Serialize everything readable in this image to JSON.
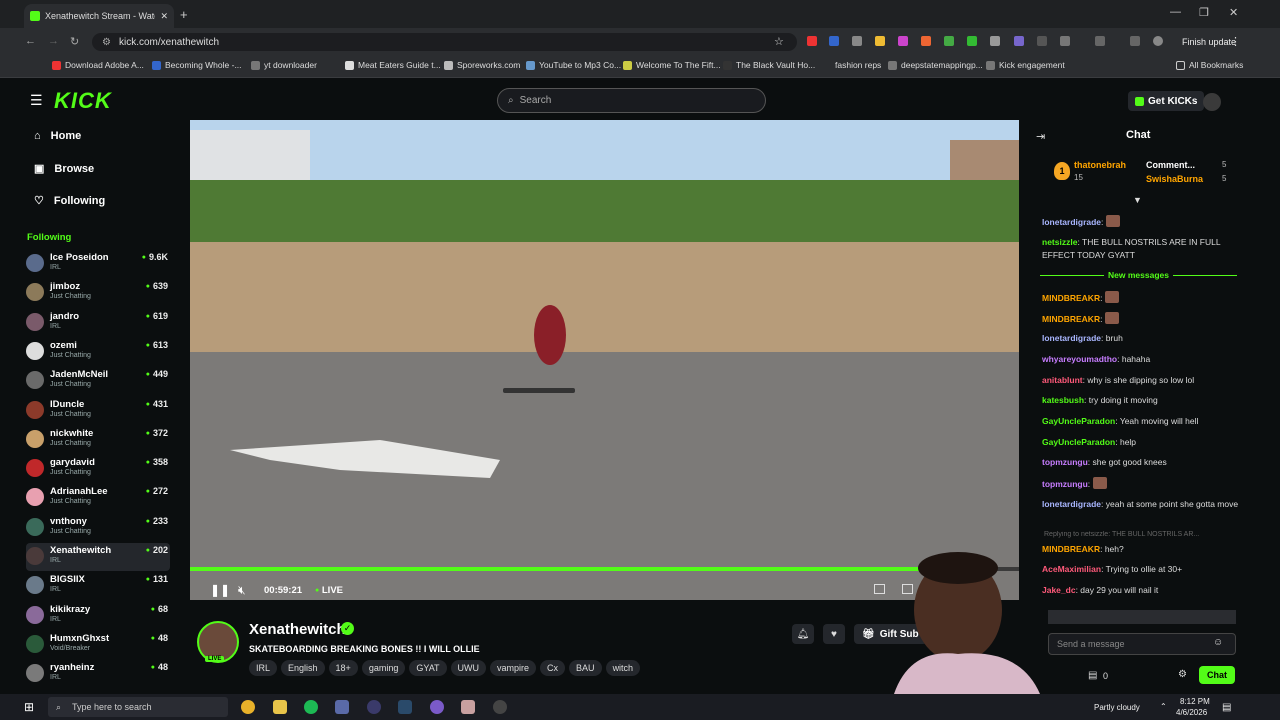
{
  "browser": {
    "tab_title": "Xenathewitch Stream - Watch l",
    "url": "kick.com/xenathewitch",
    "finish_update": "Finish update",
    "bookmarks": [
      "Download Adobe A...",
      "Becoming Whole -...",
      "yt downloader",
      "Meat Eaters Guide t...",
      "Sporeworks.com",
      "YouTube to Mp3 Co...",
      "Welcome To The Fift...",
      "The Black Vault Ho...",
      "fashion reps",
      "deepstatemappingp...",
      "Kick engagement"
    ],
    "all_bookmarks": "All Bookmarks"
  },
  "header": {
    "logo": "KICK",
    "search_placeholder": "Search",
    "get_kicks": "Get KICKs"
  },
  "nav": {
    "home": "Home",
    "browse": "Browse",
    "following": "Following"
  },
  "following_title": "Following",
  "following": [
    {
      "name": "Ice Poseidon",
      "cat": "IRL",
      "viewers": "9.6K",
      "color": "#5a6b8c"
    },
    {
      "name": "jimboz",
      "cat": "Just Chatting",
      "viewers": "639",
      "color": "#8c7a5a"
    },
    {
      "name": "jandro",
      "cat": "IRL",
      "viewers": "619",
      "color": "#7a5a6a"
    },
    {
      "name": "ozemi",
      "cat": "Just Chatting",
      "viewers": "613",
      "color": "#dddddd"
    },
    {
      "name": "JadenMcNeil",
      "cat": "Just Chatting",
      "viewers": "449",
      "color": "#6a6a6a"
    },
    {
      "name": "IDuncle",
      "cat": "Just Chatting",
      "viewers": "431",
      "color": "#8c3a2a"
    },
    {
      "name": "nickwhite",
      "cat": "Just Chatting",
      "viewers": "372",
      "color": "#c9a06a"
    },
    {
      "name": "garydavid",
      "cat": "Just Chatting",
      "viewers": "358",
      "color": "#c0282a"
    },
    {
      "name": "AdrianahLee",
      "cat": "Just Chatting",
      "viewers": "272",
      "color": "#e8a0b0"
    },
    {
      "name": "vnthony",
      "cat": "Just Chatting",
      "viewers": "233",
      "color": "#3a6a5a"
    },
    {
      "name": "Xenathewitch",
      "cat": "IRL",
      "viewers": "202",
      "color": "#4a3a3a"
    },
    {
      "name": "BIGSIIX",
      "cat": "IRL",
      "viewers": "131",
      "color": "#6a7a8a"
    },
    {
      "name": "kikikrazy",
      "cat": "IRL",
      "viewers": "68",
      "color": "#8a6a9a"
    },
    {
      "name": "HumxnGhxst",
      "cat": "Void/Breaker",
      "viewers": "48",
      "color": "#2a5a3a"
    },
    {
      "name": "ryanheinz",
      "cat": "IRL",
      "viewers": "48",
      "color": "#7a7a7a"
    }
  ],
  "player": {
    "time": "00:59:21",
    "live": "LIVE",
    "progress": 0.93
  },
  "stream": {
    "streamer": "Xenathewitch",
    "title": "SKATEBOARDING BREAKING BONES !! I WILL OLLIE",
    "live_badge": "LIVE",
    "tags": [
      "IRL",
      "English",
      "18+",
      "gaming",
      "GYAT",
      "UWU",
      "vampire",
      "Cx",
      "BAU",
      "witch"
    ],
    "gift_subs": "Gift Sub"
  },
  "chat": {
    "title": "Chat",
    "pinned": {
      "rank": "1",
      "user": "thatonebrah",
      "count": "15",
      "user2": "Comment...",
      "count2": "5",
      "user3": "SwishaBurna",
      "count3": "5"
    },
    "new_messages": "New messages",
    "messages": [
      {
        "user": "lonetardigrade",
        "color": "#a9b6ff",
        "text": ""
      },
      {
        "user": "netsizzle",
        "color": "#53fc18",
        "text": "THE BULL NOSTRILS ARE IN FULL EFFECT TODAY GYATT"
      },
      {
        "user": "MINDBREAKR",
        "color": "#ffa500",
        "text": ""
      },
      {
        "user": "MINDBREAKR",
        "color": "#ffa500",
        "text": ""
      },
      {
        "user": "lonetardigrade",
        "color": "#a9b6ff",
        "text": "bruh"
      },
      {
        "user": "whyareyoumadtho",
        "color": "#c77dff",
        "text": "hahaha"
      },
      {
        "user": "anitablunt",
        "color": "#ff5a7a",
        "text": "why is she dipping so low lol"
      },
      {
        "user": "katesbush",
        "color": "#53fc18",
        "text": "try doing it moving"
      },
      {
        "user": "GayUncleParadon",
        "color": "#53fc18",
        "text": "Yeah moving will hell"
      },
      {
        "user": "GayUncleParadon",
        "color": "#53fc18",
        "text": "help"
      },
      {
        "user": "topmzungu",
        "color": "#c77dff",
        "text": "she got good knees"
      },
      {
        "user": "topmzungu",
        "color": "#c77dff",
        "text": ""
      },
      {
        "user": "lonetardigrade",
        "color": "#a9b6ff",
        "text": "yeah at some point she gotta move"
      },
      {
        "user": "MINDBREAKR",
        "color": "#ffa500",
        "text": "heh?"
      },
      {
        "user": "AceMaximilian",
        "color": "#ff5a7a",
        "text": "Trying to ollie at 30+"
      },
      {
        "user": "Jake_dc",
        "color": "#ff5a7a",
        "text": "day 29 you will nail it"
      }
    ],
    "reply_note": "Replying to netsizzle: THE BULL NOSTRILS AR...",
    "send_placeholder": "Send a message",
    "points": "0",
    "chat_button": "Chat"
  },
  "taskbar": {
    "search": "Type here to search",
    "weather": "Partly cloudy",
    "time": "8:12 PM",
    "date": "4/6/2026"
  }
}
